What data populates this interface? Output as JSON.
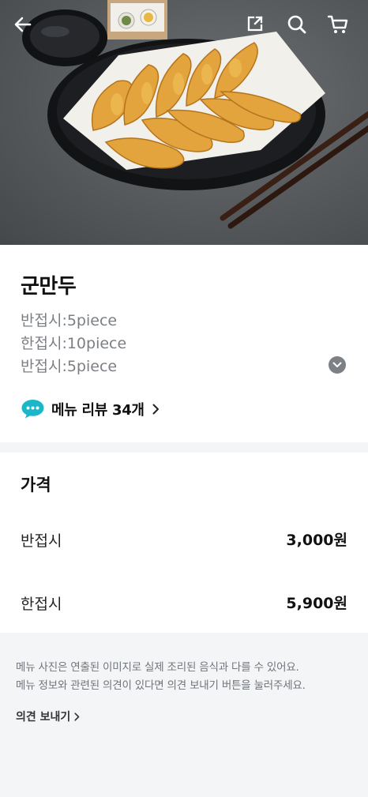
{
  "header": {
    "icons": [
      "back-arrow-icon",
      "share-icon",
      "search-icon",
      "cart-icon"
    ],
    "image": "fried dumplings on black plate with chopsticks"
  },
  "menu": {
    "title": "군만두",
    "description_lines": [
      "반접시:5piece",
      "한접시:10piece",
      "반접시:5piece"
    ],
    "review_link_label": "메뉴 리뷰 34개"
  },
  "price_section": {
    "heading": "가격",
    "options": [
      {
        "name": "반접시",
        "price": "3,000원"
      },
      {
        "name": "한접시",
        "price": "5,900원"
      }
    ]
  },
  "notice": {
    "lines": [
      "메뉴 사진은 연출된 이미지로 실제 조리된 음식과 다를 수 있어요.",
      "메뉴 정보와 관련된 의견이 있다면 의견 보내기 버튼을 눌러주세요."
    ],
    "feedback_label": "의견 보내기"
  },
  "colors": {
    "accent_review_icon": "#1bb6c8",
    "background": "#f4f5f7"
  }
}
